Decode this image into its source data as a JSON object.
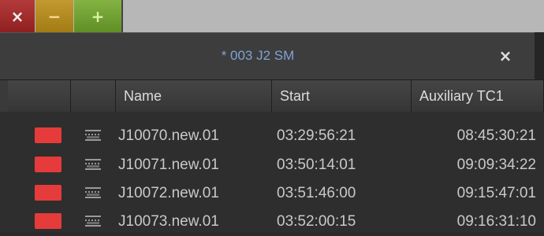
{
  "window": {
    "close_glyph": "×",
    "minimize_glyph": "−",
    "maximize_glyph": "+"
  },
  "bin": {
    "title": "* 003 J2 SM",
    "close_glyph": "×"
  },
  "columns": [
    "",
    "",
    "Name",
    "Start",
    "Auxiliary TC1"
  ],
  "rows": [
    {
      "color": "#e63b3b",
      "icon": "clip-icon",
      "name": "J10070.new.01",
      "start": "03:29:56:21",
      "aux": "08:45:30:21"
    },
    {
      "color": "#e63b3b",
      "icon": "clip-icon",
      "name": "J10071.new.01",
      "start": "03:50:14:01",
      "aux": "09:09:34:22"
    },
    {
      "color": "#e63b3b",
      "icon": "clip-icon",
      "name": "J10072.new.01",
      "start": "03:51:46:00",
      "aux": "09:15:47:01"
    },
    {
      "color": "#e63b3b",
      "icon": "clip-icon",
      "name": "J10073.new.01",
      "start": "03:52:00:15",
      "aux": "09:16:31:10"
    }
  ]
}
